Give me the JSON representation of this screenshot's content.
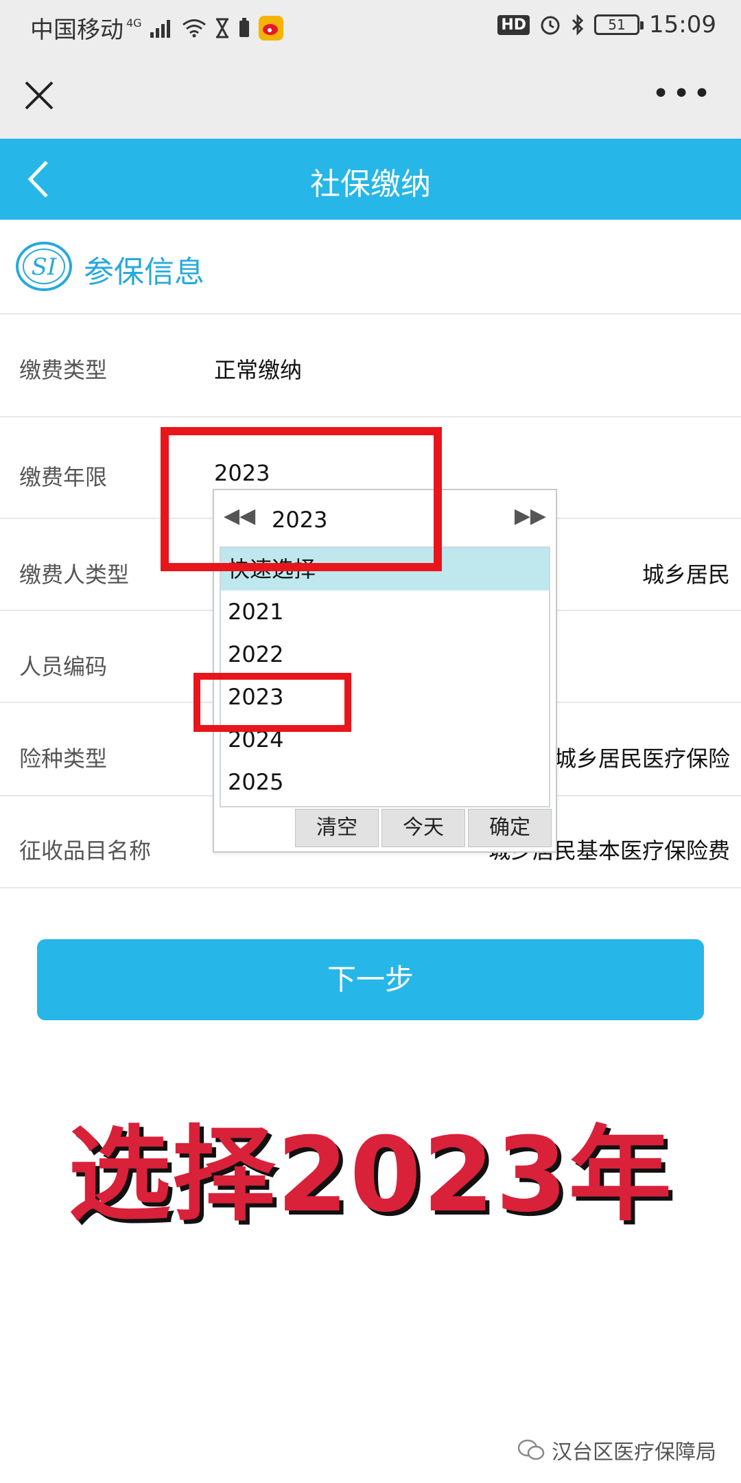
{
  "status_bar": {
    "carrier": "中国移动",
    "network": "4G",
    "hd": "HD",
    "battery": "51",
    "time": "15:09",
    "icons": [
      "signal-icon",
      "wifi-icon",
      "hourglass-icon",
      "battery-small-icon",
      "weibo-icon",
      "alarm-icon",
      "bluetooth-icon"
    ]
  },
  "wechat_bar": {
    "close_icon": "close-icon",
    "more": "•••"
  },
  "header": {
    "title": "社保缴纳",
    "back_icon": "chevron-left-icon"
  },
  "section": {
    "title": "参保信息",
    "logo": "SI"
  },
  "form": {
    "rows": [
      {
        "label": "缴费类型",
        "value": "正常缴纳"
      },
      {
        "label": "缴费年限",
        "value": "2023"
      },
      {
        "label": "缴费人类型",
        "value": "城乡居民"
      },
      {
        "label": "人员编码",
        "value": ""
      },
      {
        "label": "险种类型",
        "value": "城乡居民医疗保险"
      },
      {
        "label": "征收品目名称",
        "value": "城乡居民基本医疗保险费"
      }
    ]
  },
  "picker": {
    "prev": "◀◀",
    "next": "▶▶",
    "current": "2023",
    "options": [
      "快速选择",
      "2021",
      "2022",
      "2023",
      "2024",
      "2025"
    ],
    "buttons": {
      "clear": "清空",
      "today": "今天",
      "confirm": "确定"
    }
  },
  "next_button": "下一步",
  "caption": "选择2023年",
  "watermark": "汉台区医疗保障局",
  "colors": {
    "brand_blue": "#27b6e8",
    "annotation_red": "#e8151b",
    "caption_red": "#d9213a"
  }
}
